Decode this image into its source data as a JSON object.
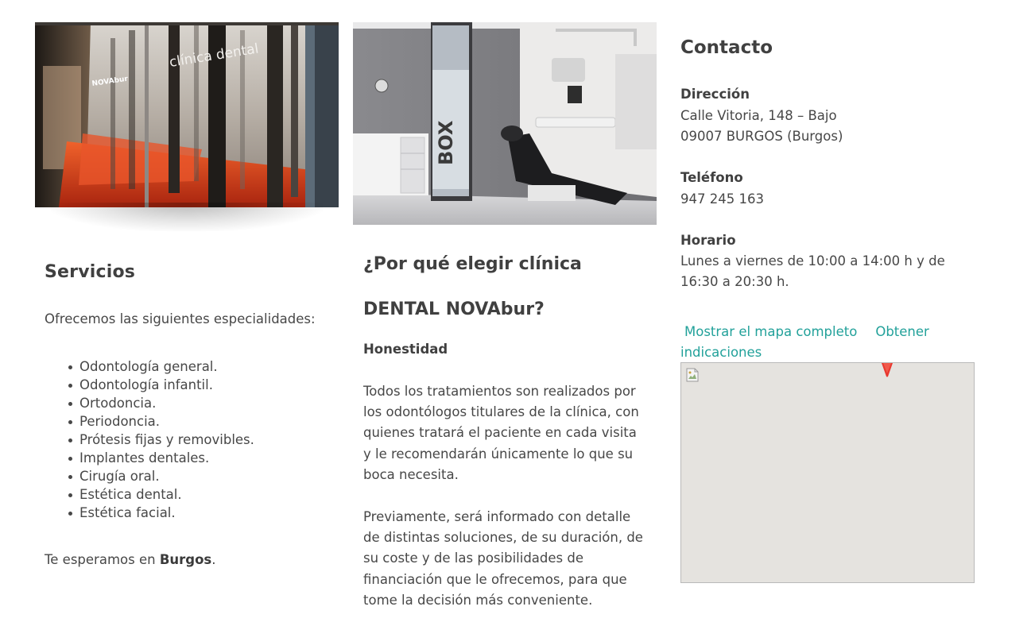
{
  "servicios": {
    "title": "Servicios",
    "intro": "Ofrecemos las siguientes especialidades:",
    "items": [
      "Odontología general.",
      "Odontología infantil.",
      "Ortodoncia.",
      "Periodoncia.",
      "Prótesis fijas y removibles.",
      "Implantes dentales.",
      "Cirugía oral.",
      "Estética dental.",
      "Estética facial."
    ],
    "closing_prefix": "Te esperamos en ",
    "closing_city": "Burgos",
    "closing_suffix": "."
  },
  "photos": {
    "facade_sign": "clínica dental",
    "facade_logo": "NOVAbur",
    "box_sign": "BOX"
  },
  "why": {
    "title": "¿Por qué elegir clínica DENTAL NOVAbur?",
    "honesty_title": "Honestidad",
    "paragraph1": "Todos los tratamientos son realizados por los odontólogos titulares de la clínica, con quienes tratará el paciente en cada visita y le recomendarán únicamente lo que su boca necesita.",
    "paragraph2": "Previamente, será informado con detalle de distintas soluciones, de su duración, de su coste y de las posibilidades de financiación que le ofrecemos, para que tome la decisión más conveniente."
  },
  "contact": {
    "title": "Contacto",
    "address_label": "Dirección",
    "address_line1": "Calle Vitoria, 148 – Bajo",
    "address_line2": "09007 BURGOS (Burgos)",
    "phone_label": "Teléfono",
    "phone": "947 245 163",
    "hours_label": "Horario",
    "hours": "Lunes a viernes de 10:00 a 14:00 h y de 16:30 a 20:30 h.",
    "map_full_link": "Mostrar el mapa completo",
    "directions_link": "Obtener indicaciones"
  },
  "colors": {
    "link": "#22a19a",
    "heading": "#404040",
    "body_text": "#474747",
    "map_background": "#e5e3df",
    "marker": "#e8382f"
  },
  "icons": {
    "map_placeholder": "broken-image-icon",
    "map_pin": "map-marker-icon"
  }
}
